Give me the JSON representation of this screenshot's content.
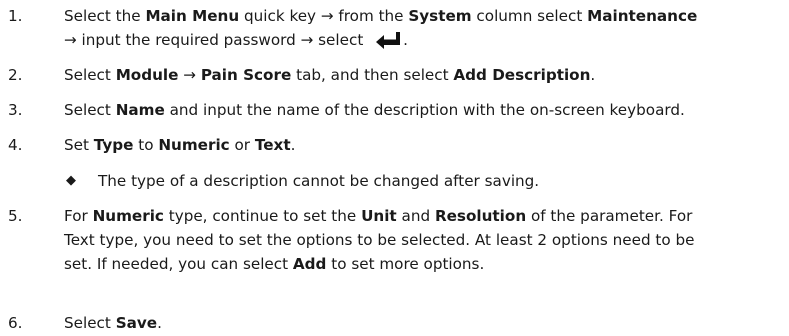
{
  "steps": [
    {
      "number": "1.",
      "lines": [
        [
          {
            "t": "Select the ",
            "b": false
          },
          {
            "t": "Main Menu",
            "b": true
          },
          {
            "t": " quick key → from the ",
            "b": false
          },
          {
            "t": "System",
            "b": true
          },
          {
            "t": " column select ",
            "b": false
          },
          {
            "t": "Maintenance",
            "b": true
          }
        ],
        [
          {
            "t": "→ input the required password → select ",
            "b": false
          },
          {
            "icon": "enter-key-icon"
          },
          {
            "t": ".",
            "b": false
          }
        ]
      ]
    },
    {
      "number": "2.",
      "lines": [
        [
          {
            "t": "Select ",
            "b": false
          },
          {
            "t": "Module",
            "b": true
          },
          {
            "t": " → ",
            "b": false
          },
          {
            "t": "Pain Score",
            "b": true
          },
          {
            "t": " tab, and then select ",
            "b": false
          },
          {
            "t": "Add Description",
            "b": true
          },
          {
            "t": ".",
            "b": false
          }
        ]
      ]
    },
    {
      "number": "3.",
      "lines": [
        [
          {
            "t": "Select ",
            "b": false
          },
          {
            "t": "Name",
            "b": true
          },
          {
            "t": " and input the name of the description with the on-screen keyboard.",
            "b": false
          }
        ]
      ]
    },
    {
      "number": "4.",
      "lines": [
        [
          {
            "t": "Set ",
            "b": false
          },
          {
            "t": "Type",
            "b": true
          },
          {
            "t": " to ",
            "b": false
          },
          {
            "t": "Numeric",
            "b": true
          },
          {
            "t": " or ",
            "b": false
          },
          {
            "t": "Text",
            "b": true
          },
          {
            "t": ".",
            "b": false
          }
        ]
      ]
    },
    {
      "number": "5.",
      "lines": [
        [
          {
            "t": "For ",
            "b": false
          },
          {
            "t": "Numeric",
            "b": true
          },
          {
            "t": " type, continue to set the ",
            "b": false
          },
          {
            "t": "Unit",
            "b": true
          },
          {
            "t": " and ",
            "b": false
          },
          {
            "t": "Resolution",
            "b": true
          },
          {
            "t": " of the parameter. For",
            "b": false
          }
        ],
        [
          {
            "t": "Text type, you need to set the options to be selected. At least 2 options need to be",
            "b": false
          }
        ],
        [
          {
            "t": "set. If needed, you can select ",
            "b": false
          },
          {
            "t": "Add",
            "b": true
          },
          {
            "t": " to set more options.",
            "b": false
          }
        ]
      ]
    },
    {
      "number": "6.",
      "lines": [
        [
          {
            "t": "Select ",
            "b": false
          },
          {
            "t": "Save",
            "b": true
          },
          {
            "t": ".",
            "b": false
          }
        ]
      ]
    }
  ],
  "note": {
    "glyph": "◆",
    "text": "The type of a description cannot be changed after saving."
  },
  "colors": {
    "text": "#1a1a1a",
    "icon": "#111111"
  }
}
